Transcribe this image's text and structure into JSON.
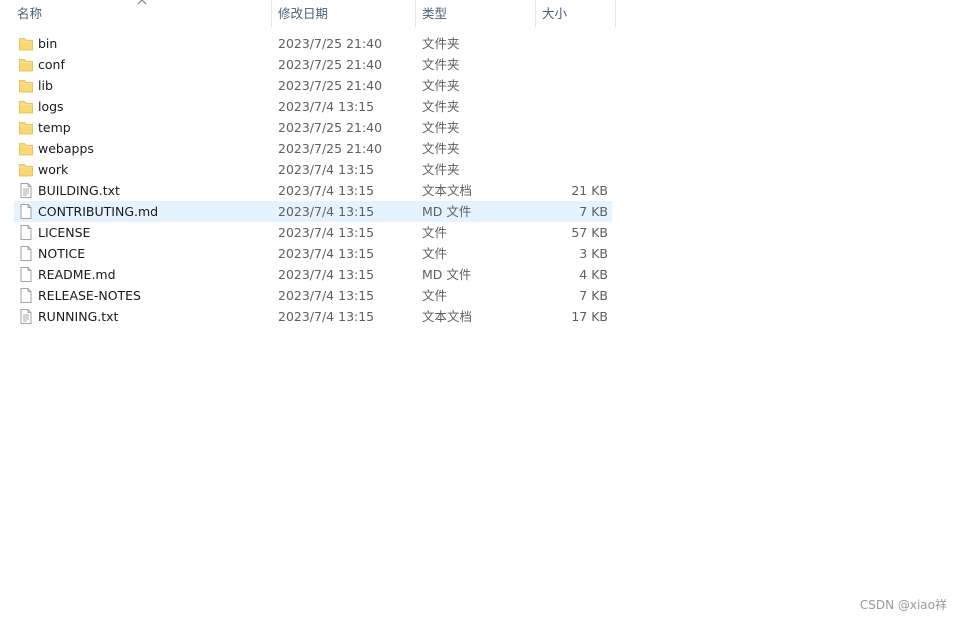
{
  "columns": {
    "name": "名称",
    "date": "修改日期",
    "type": "类型",
    "size": "大小"
  },
  "files": [
    {
      "name": "bin",
      "date": "2023/7/25 21:40",
      "type": "文件夹",
      "size": "",
      "icon": "folder-icon"
    },
    {
      "name": "conf",
      "date": "2023/7/25 21:40",
      "type": "文件夹",
      "size": "",
      "icon": "folder-icon"
    },
    {
      "name": "lib",
      "date": "2023/7/25 21:40",
      "type": "文件夹",
      "size": "",
      "icon": "folder-icon"
    },
    {
      "name": "logs",
      "date": "2023/7/4 13:15",
      "type": "文件夹",
      "size": "",
      "icon": "folder-icon"
    },
    {
      "name": "temp",
      "date": "2023/7/25 21:40",
      "type": "文件夹",
      "size": "",
      "icon": "folder-icon"
    },
    {
      "name": "webapps",
      "date": "2023/7/25 21:40",
      "type": "文件夹",
      "size": "",
      "icon": "folder-icon"
    },
    {
      "name": "work",
      "date": "2023/7/4 13:15",
      "type": "文件夹",
      "size": "",
      "icon": "folder-icon"
    },
    {
      "name": "BUILDING.txt",
      "date": "2023/7/4 13:15",
      "type": "文本文档",
      "size": "21 KB",
      "icon": "text-file-icon"
    },
    {
      "name": "CONTRIBUTING.md",
      "date": "2023/7/4 13:15",
      "type": "MD 文件",
      "size": "7 KB",
      "icon": "file-icon"
    },
    {
      "name": "LICENSE",
      "date": "2023/7/4 13:15",
      "type": "文件",
      "size": "57 KB",
      "icon": "file-icon"
    },
    {
      "name": "NOTICE",
      "date": "2023/7/4 13:15",
      "type": "文件",
      "size": "3 KB",
      "icon": "file-icon"
    },
    {
      "name": "README.md",
      "date": "2023/7/4 13:15",
      "type": "MD 文件",
      "size": "4 KB",
      "icon": "file-icon"
    },
    {
      "name": "RELEASE-NOTES",
      "date": "2023/7/4 13:15",
      "type": "文件",
      "size": "7 KB",
      "icon": "file-icon"
    },
    {
      "name": "RUNNING.txt",
      "date": "2023/7/4 13:15",
      "type": "文本文档",
      "size": "17 KB",
      "icon": "text-file-icon"
    }
  ],
  "selected_file": "CONTRIBUTING.md",
  "watermark": "CSDN @xiao祥",
  "colors": {
    "selection": "#e5f3ff",
    "folder": "#f8d775",
    "header_text": "#4c607a"
  }
}
